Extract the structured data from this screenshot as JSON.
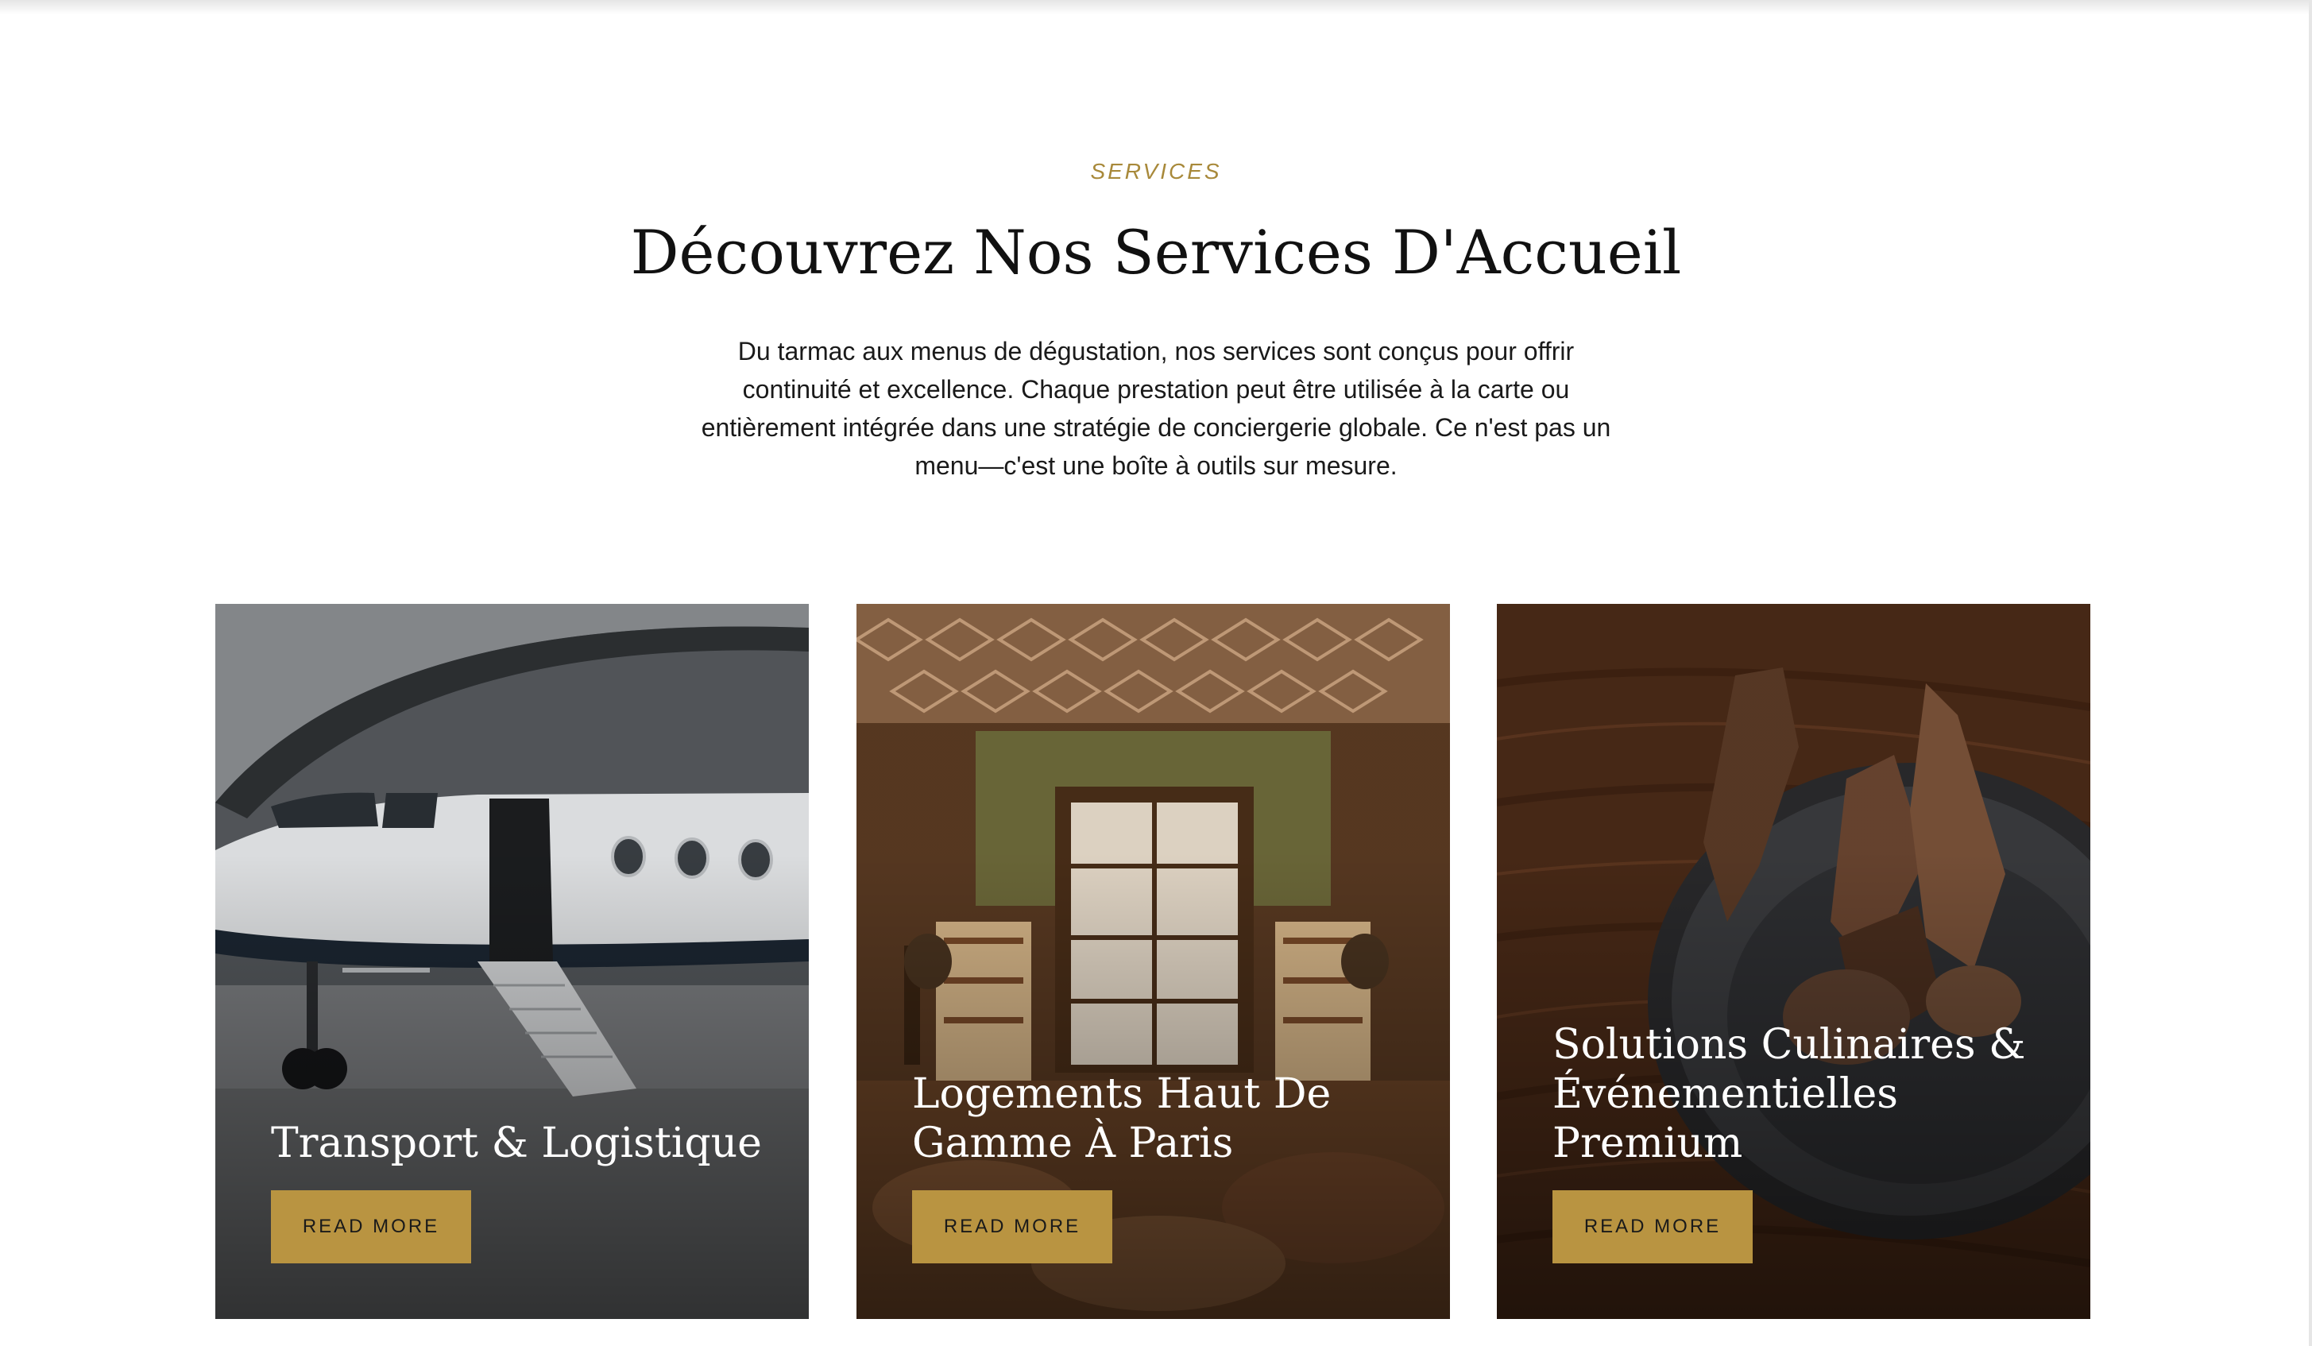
{
  "section": {
    "eyebrow": "SERVICES",
    "title": "Découvrez Nos Services D'Accueil",
    "intro": "Du tarmac aux menus de dégustation, nos services sont conçus pour offrir continuité et excellence. Chaque prestation peut être utilisée à la carte ou entièrement intégrée dans une stratégie de conciergerie globale. Ce n'est pas un menu—c'est une boîte à outils sur mesure."
  },
  "cards": [
    {
      "title": "Transport & Logistique",
      "button": "READ MORE",
      "image": "private-jet-photo"
    },
    {
      "title": "Logements Haut De Gamme À Paris",
      "button": "READ MORE",
      "image": "paris-lounge-photo"
    },
    {
      "title": "Solutions Culinaires & Événementielles Premium",
      "button": "READ MORE",
      "image": "plated-dessert-photo"
    }
  ],
  "colors": {
    "accent": "#b99441",
    "eyebrow": "#a8893a",
    "heading": "#111111",
    "body_text": "#1a1a1a"
  }
}
